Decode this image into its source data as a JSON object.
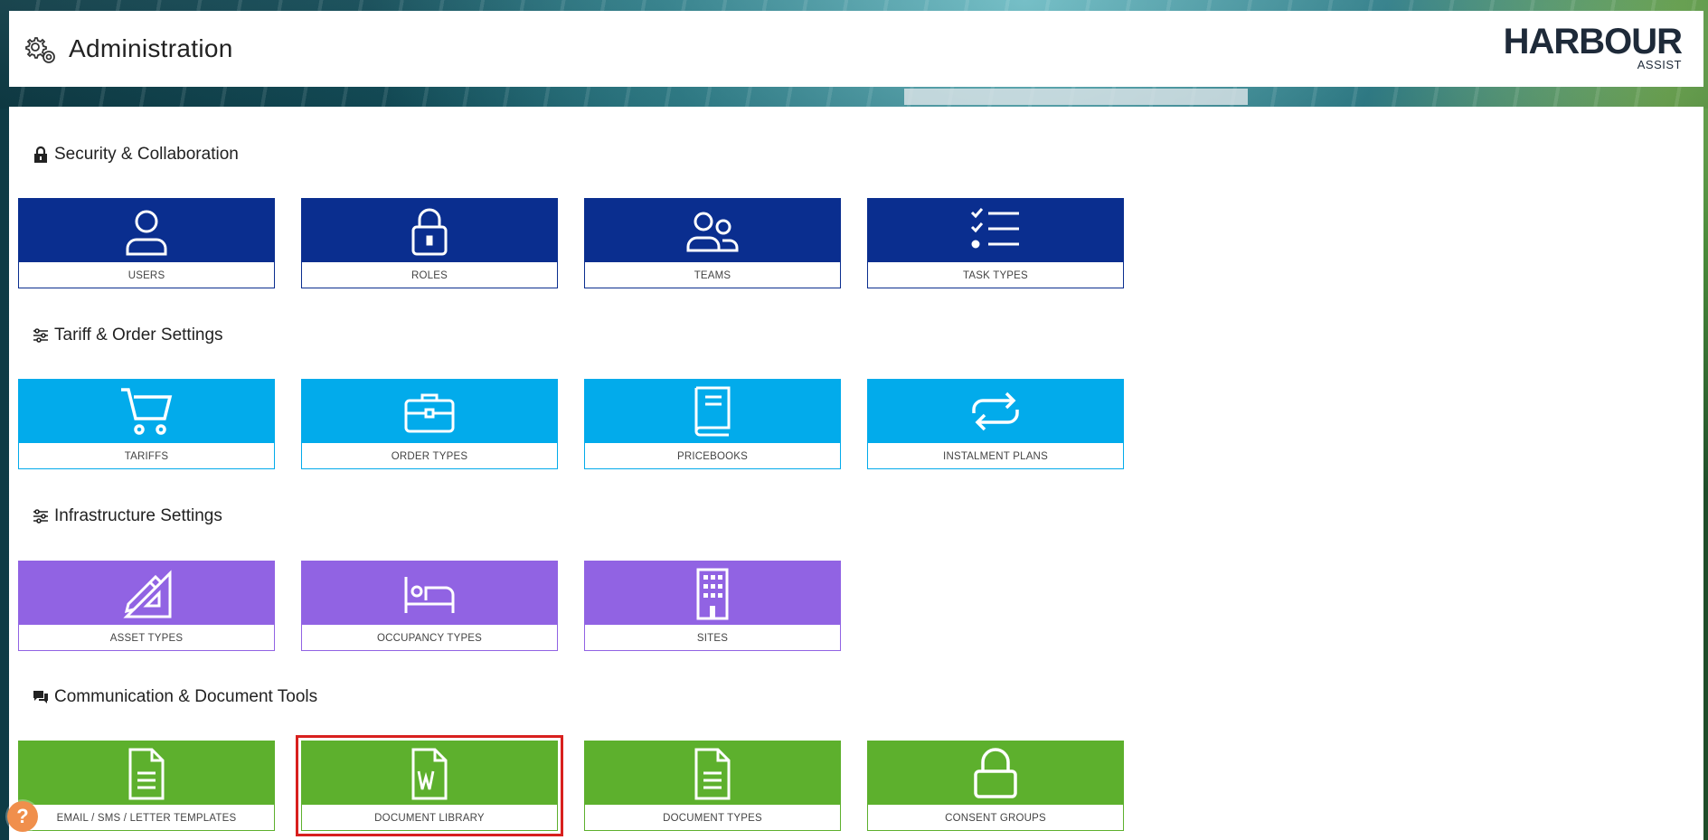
{
  "header": {
    "title": "Administration",
    "logo_main": "HARBOUR",
    "logo_sub": "ASSIST"
  },
  "sections": [
    {
      "title": "Security & Collaboration",
      "icon": "lock-icon",
      "color": "#0a2e8f",
      "tiles": [
        {
          "label": "USERS",
          "icon": "user-icon"
        },
        {
          "label": "ROLES",
          "icon": "lock-icon"
        },
        {
          "label": "TEAMS",
          "icon": "users-icon"
        },
        {
          "label": "TASK TYPES",
          "icon": "checklist-icon"
        }
      ]
    },
    {
      "title": "Tariff & Order Settings",
      "icon": "sliders-icon",
      "color": "#02abeb",
      "tiles": [
        {
          "label": "TARIFFS",
          "icon": "cart-icon"
        },
        {
          "label": "ORDER TYPES",
          "icon": "briefcase-icon"
        },
        {
          "label": "PRICEBOOKS",
          "icon": "book-icon"
        },
        {
          "label": "INSTALMENT PLANS",
          "icon": "repeat-icon"
        }
      ]
    },
    {
      "title": "Infrastructure Settings",
      "icon": "sliders-icon",
      "color": "#9163e3",
      "tiles": [
        {
          "label": "ASSET TYPES",
          "icon": "ruler-pencil-icon"
        },
        {
          "label": "OCCUPANCY TYPES",
          "icon": "bed-icon"
        },
        {
          "label": "SITES",
          "icon": "building-icon"
        }
      ]
    },
    {
      "title": "Communication & Document Tools",
      "icon": "comments-icon",
      "color": "#5db02d",
      "tiles": [
        {
          "label": "EMAIL / SMS / LETTER TEMPLATES",
          "icon": "document-icon"
        },
        {
          "label": "DOCUMENT LIBRARY",
          "icon": "word-document-icon"
        },
        {
          "label": "DOCUMENT TYPES",
          "icon": "document-icon"
        },
        {
          "label": "CONSENT GROUPS",
          "icon": "lock-icon"
        }
      ]
    }
  ],
  "help": {
    "label": "?"
  }
}
